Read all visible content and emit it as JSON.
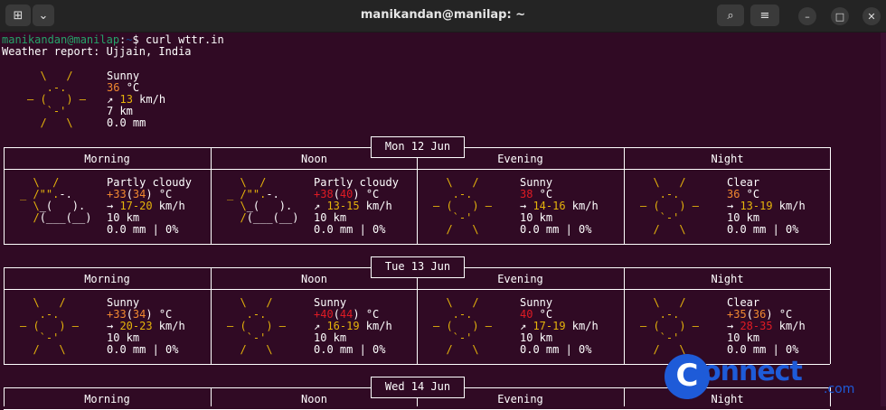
{
  "window": {
    "title": "manikandan@manilap: ~",
    "new_tab_icon": "new-tab-icon",
    "menu_icon": "chevron-down-icon"
  },
  "prompt": {
    "user_host": "manikandan@manilap",
    "path": "~",
    "symbol": "$",
    "command": "curl wttr.in"
  },
  "report": {
    "location_line": "Weather report: Ujjain, India",
    "current": {
      "art": [
        "  \\   /  ",
        "   .-.   ",
        "― (   ) ―",
        "   `-'   ",
        "  /   \\  "
      ],
      "condition": "Sunny",
      "temp": "36",
      "temp_unit": "°C",
      "wind_arrow": "↗",
      "wind": "13",
      "wind_unit": "km/h",
      "visibility": "7 km",
      "precip": "0.0 mm"
    }
  },
  "days": [
    {
      "date": "Mon 12 Jun",
      "periods": [
        {
          "name": "Morning",
          "condition": "Partly cloudy",
          "temp_pre": "+33",
          "temp_paren": "34",
          "temp_unit": "°C",
          "wind_arrow": "→",
          "wind": "17-20",
          "wind_unit": "km/h",
          "visibility": "10 km",
          "precip": "0.0 mm | 0%"
        },
        {
          "name": "Noon",
          "condition": "Partly cloudy",
          "temp_pre": "+38",
          "temp_paren": "40",
          "temp_unit": "°C",
          "wind_arrow": "↗",
          "wind": "13-15",
          "wind_unit": "km/h",
          "visibility": "10 km",
          "precip": "0.0 mm | 0%"
        },
        {
          "name": "Evening",
          "condition": "Sunny",
          "temp_pre": "38",
          "temp_paren": "",
          "temp_unit": "°C",
          "wind_arrow": "→",
          "wind": "14-16",
          "wind_unit": "km/h",
          "visibility": "10 km",
          "precip": "0.0 mm | 0%"
        },
        {
          "name": "Night",
          "condition": "Clear",
          "temp_pre": "36",
          "temp_paren": "",
          "temp_unit": "°C",
          "wind_arrow": "→",
          "wind": "13-19",
          "wind_unit": "km/h",
          "visibility": "10 km",
          "precip": "0.0 mm | 0%"
        }
      ]
    },
    {
      "date": "Tue 13 Jun",
      "periods": [
        {
          "name": "Morning",
          "condition": "Sunny",
          "temp_pre": "+33",
          "temp_paren": "34",
          "temp_unit": "°C",
          "wind_arrow": "→",
          "wind": "20-23",
          "wind_unit": "km/h",
          "visibility": "10 km",
          "precip": "0.0 mm | 0%"
        },
        {
          "name": "Noon",
          "condition": "Sunny",
          "temp_pre": "+40",
          "temp_paren": "44",
          "temp_unit": "°C",
          "wind_arrow": "↗",
          "wind": "16-19",
          "wind_unit": "km/h",
          "visibility": "10 km",
          "precip": "0.0 mm | 0%"
        },
        {
          "name": "Evening",
          "condition": "Sunny",
          "temp_pre": "40",
          "temp_paren": "",
          "temp_unit": "°C",
          "wind_arrow": "↗",
          "wind": "17-19",
          "wind_unit": "km/h",
          "visibility": "10 km",
          "precip": "0.0 mm | 0%"
        },
        {
          "name": "Night",
          "condition": "Clear",
          "temp_pre": "+35",
          "temp_paren": "36",
          "temp_unit": "°C",
          "wind_arrow": "→",
          "wind": "28-35",
          "wind_unit": "km/h",
          "visibility": "10 km",
          "precip": "0.0 mm | 0%"
        }
      ]
    },
    {
      "date": "Wed 14 Jun",
      "periods": [
        {
          "name": "Morning"
        },
        {
          "name": "Noon"
        },
        {
          "name": "Evening"
        },
        {
          "name": "Night"
        }
      ]
    }
  ],
  "art": {
    "sun": [
      "  \\   /  ",
      "   .-.   ",
      "― (   ) ―",
      "   `-'   ",
      "  /   \\  "
    ],
    "partly": [
      "  \\  /   ",
      "_ /\"\".-.  ",
      "  \\_(   ). ",
      "  /(___(__) ",
      "           "
    ]
  },
  "watermark": {
    "logo_letter": "C",
    "brand": "onnect",
    "suffix": ".com"
  },
  "colors": {
    "terminal_bg": "#300a24",
    "prompt_user": "#26a269",
    "sun": "#e5b30b",
    "temp_hot": "#e01b24",
    "temp_warm": "#f08830",
    "wind": "#e5b30b",
    "brand": "#1e5bd8"
  }
}
